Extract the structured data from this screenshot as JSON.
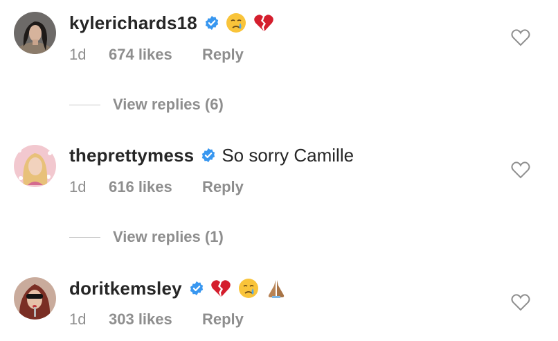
{
  "colors": {
    "text": "#262626",
    "muted": "#8e8e8e",
    "verified": "#3897f0",
    "divider": "#c7c7c7"
  },
  "comments": [
    {
      "username": "kylerichards18",
      "text": "",
      "emojis": [
        "crying-face",
        "broken-heart"
      ],
      "time": "1d",
      "likes": "674 likes",
      "reply": "Reply",
      "view_replies": "View replies (6)"
    },
    {
      "username": "theprettymess",
      "text": "So sorry Camille",
      "emojis": [],
      "time": "1d",
      "likes": "616 likes",
      "reply": "Reply",
      "view_replies": "View replies (1)"
    },
    {
      "username": "doritkemsley",
      "text": "",
      "emojis": [
        "broken-heart",
        "crying-face",
        "folded-hands"
      ],
      "time": "1d",
      "likes": "303 likes",
      "reply": "Reply"
    }
  ],
  "icons": {
    "verified": "verified-badge-icon",
    "like": "heart-outline-icon"
  }
}
